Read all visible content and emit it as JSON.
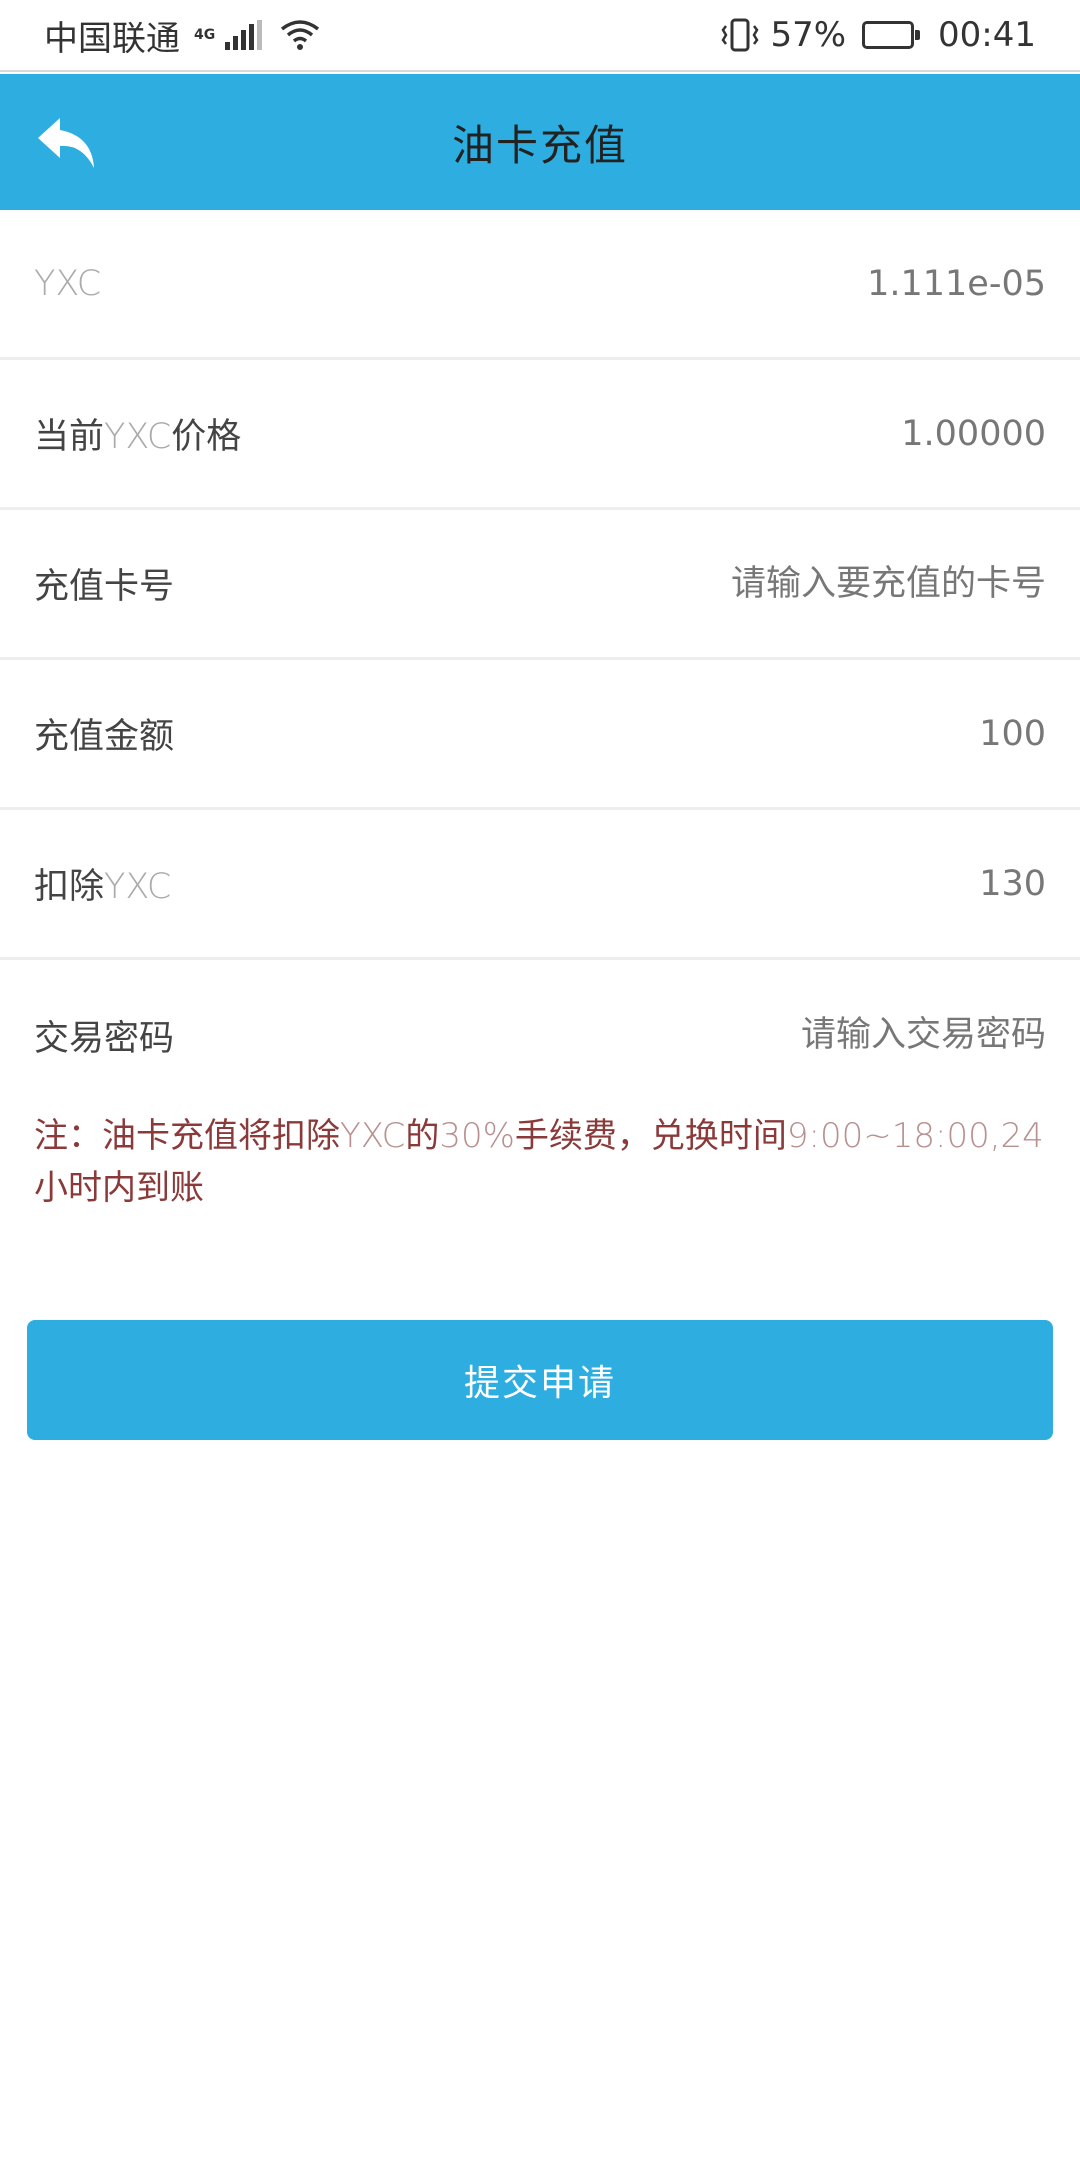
{
  "status_bar": {
    "carrier": "中国联通",
    "network": "4G",
    "battery_percent": "57%",
    "battery_level": 0.57,
    "time": "00:41"
  },
  "header": {
    "title": "油卡充值",
    "back_icon": "back-arrow-icon"
  },
  "rows": {
    "yxc": {
      "label": "YXC",
      "value": "1.111e-05"
    },
    "price": {
      "label_prefix": "当前",
      "label_latin": "YXC",
      "label_suffix": "价格",
      "value": "1.00000"
    },
    "card_number": {
      "label": "充值卡号",
      "placeholder": "请输入要充值的卡号"
    },
    "amount": {
      "label": "充值金额",
      "value": "100"
    },
    "deduct": {
      "label_prefix": "扣除",
      "label_latin": "YXC",
      "value": "130"
    },
    "password": {
      "label": "交易密码",
      "placeholder": "请输入交易密码"
    }
  },
  "note": {
    "part1": " 注：油卡充值将扣除",
    "part2": "YXC",
    "part3": "的",
    "part4": "30%",
    "part5": "手续费，兑换时间",
    "part6": "9:00~18:00,24",
    "part7": "小时内到账"
  },
  "submit": {
    "label": "提交申请"
  },
  "colors": {
    "accent": "#2eaee0",
    "note_text": "#8b3a3a"
  }
}
